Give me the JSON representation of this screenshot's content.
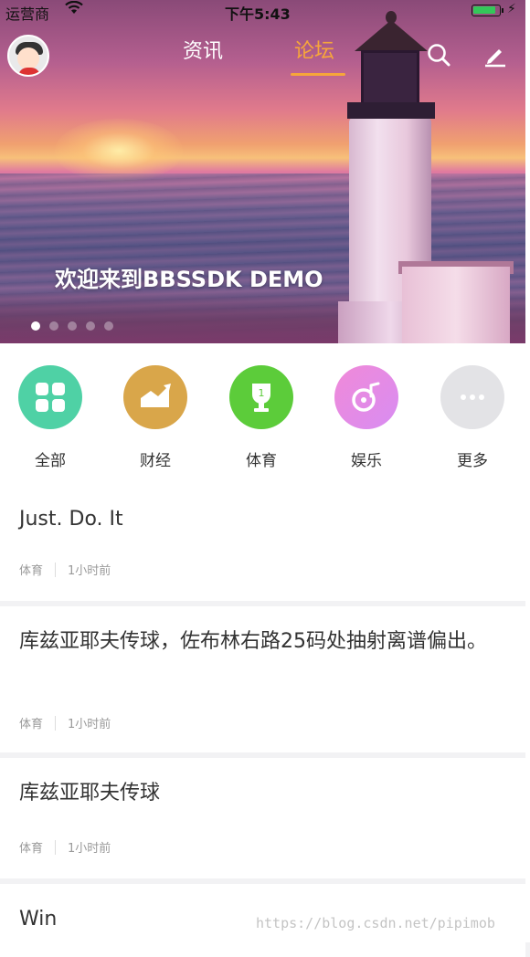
{
  "status_bar": {
    "carrier": "运营商",
    "time": "下午5:43",
    "battery_level": 0.9
  },
  "header": {
    "tabs": [
      {
        "label": "资讯",
        "active": false
      },
      {
        "label": "论坛",
        "active": true
      }
    ],
    "accent_color": "#f7a63a",
    "icons": [
      "avatar",
      "search-icon",
      "edit-icon"
    ]
  },
  "banner": {
    "text": "欢迎来到BBSSDK DEMO",
    "page_count": 5,
    "current_page": 1
  },
  "categories": [
    {
      "label": "全部",
      "icon": "grid-icon",
      "color": "#4fd1a5"
    },
    {
      "label": "财经",
      "icon": "trend-chart-icon",
      "color": "#d9a64a"
    },
    {
      "label": "体育",
      "icon": "trophy-icon",
      "color": "#5ccc3a"
    },
    {
      "label": "娱乐",
      "icon": "music-disc-icon",
      "color": "#e58ae8"
    },
    {
      "label": "更多",
      "icon": "more-icon",
      "color": "#e3e3e6"
    }
  ],
  "posts": [
    {
      "title": "Just. Do. It",
      "category": "体育",
      "time": "1小时前"
    },
    {
      "title": "库兹亚耶夫传球，佐布林右路25码处抽射离谱偏出。",
      "category": "体育",
      "time": "1小时前"
    },
    {
      "title": "库兹亚耶夫传球",
      "category": "体育",
      "time": "1小时前"
    },
    {
      "title": "Win",
      "category": "",
      "time": ""
    }
  ],
  "watermark": "https://blog.csdn.net/pipimob"
}
